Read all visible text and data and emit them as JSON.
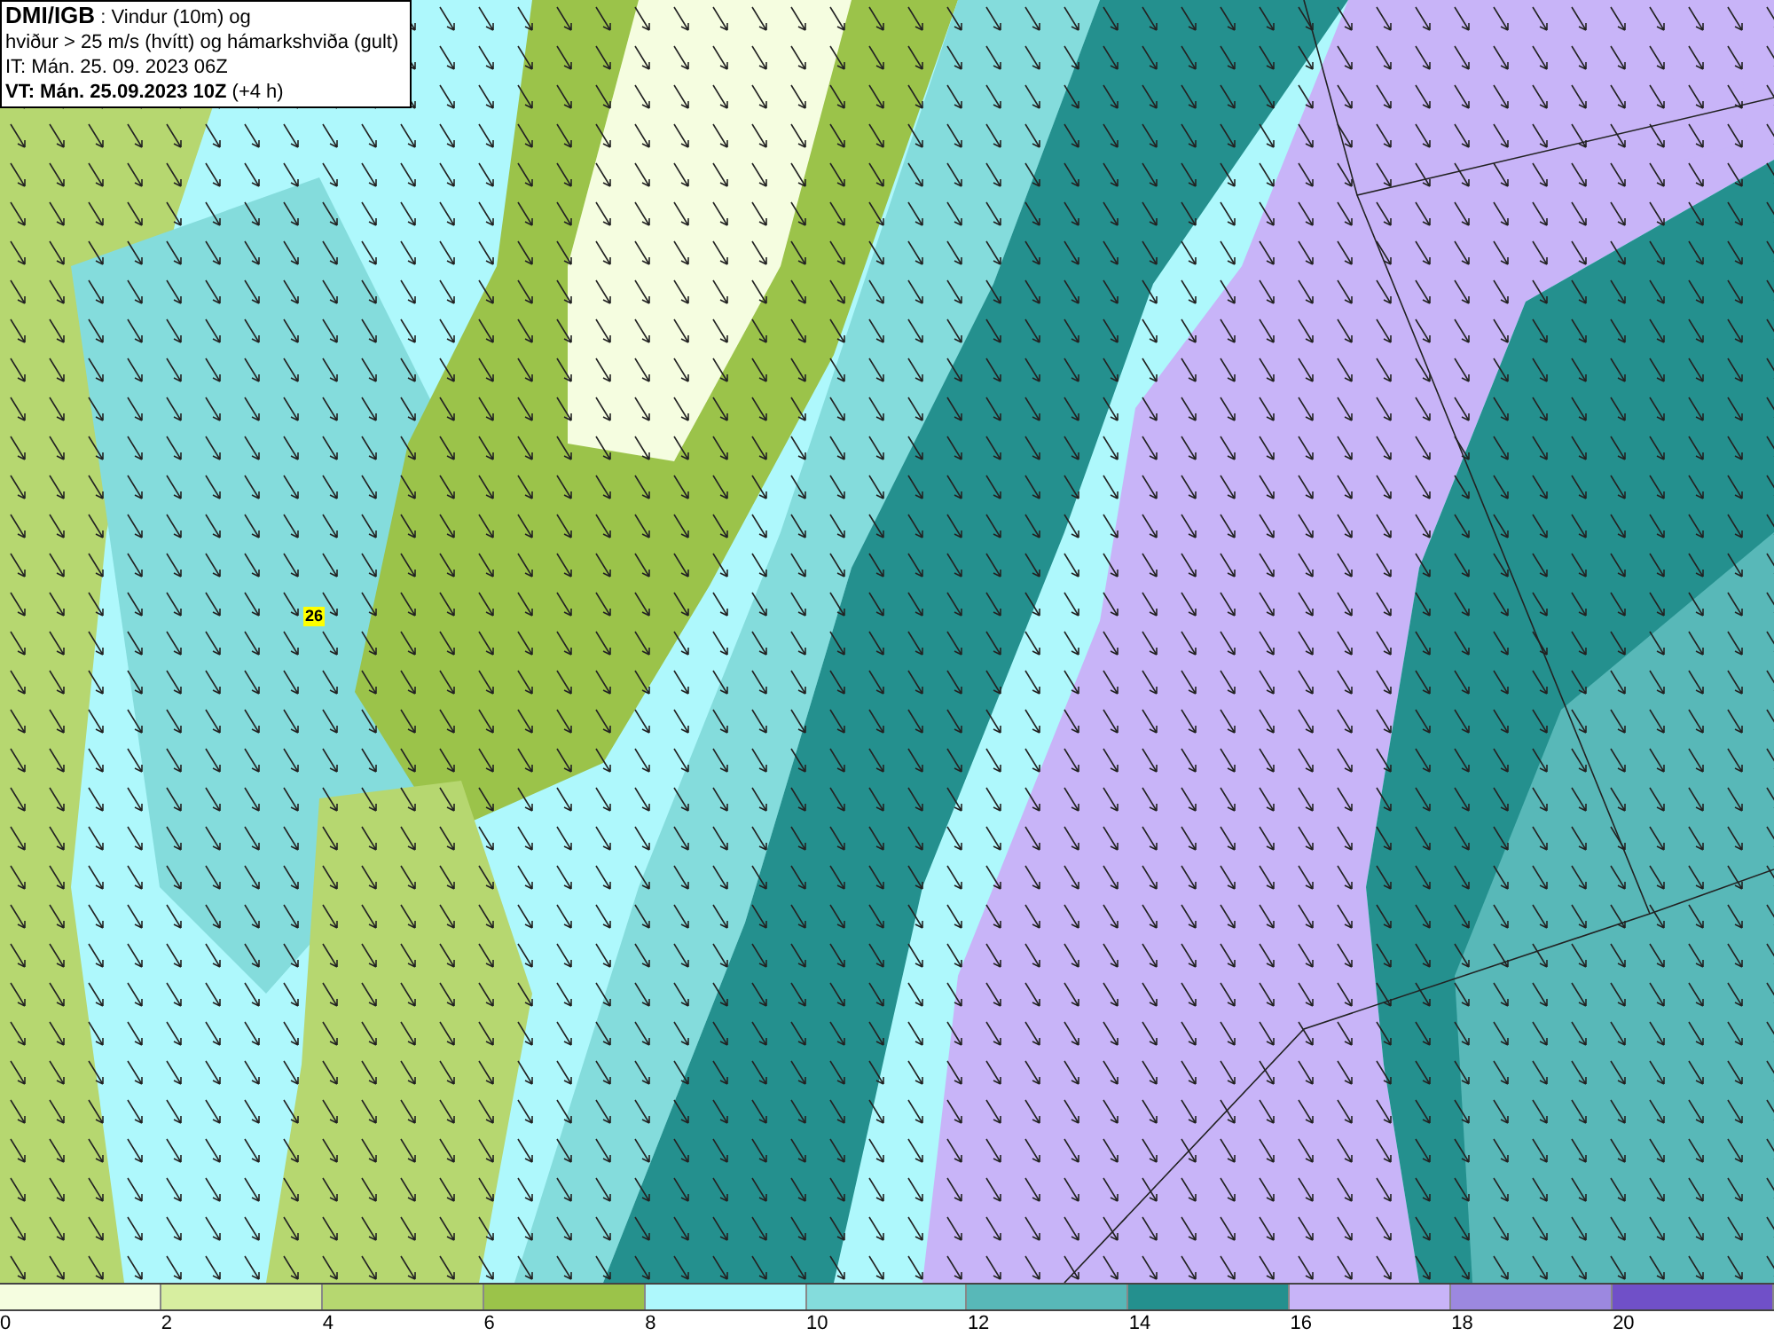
{
  "header": {
    "source": "DMI/IGB",
    "title": ": Vindur (10m) og",
    "subtitle": "hviður > 25 m/s (hvítt) og hámarkshviða (gult)",
    "issue_time": "IT: Mán. 25. 09. 2023 06Z",
    "valid_time": "VT: Mán. 25.09.2023 10Z",
    "lead": "(+4 h)"
  },
  "gust_marker": {
    "value": "26"
  },
  "legend": {
    "bins": [
      {
        "color": "#f5fde0"
      },
      {
        "color": "#d7eea0"
      },
      {
        "color": "#b6d770"
      },
      {
        "color": "#9bc34a"
      },
      {
        "color": "#aef8fc"
      },
      {
        "color": "#84dcdc"
      },
      {
        "color": "#58b8b8"
      },
      {
        "color": "#24908e"
      },
      {
        "color": "#c8b4f8"
      },
      {
        "color": "#9c88e0"
      },
      {
        "color": "#7050c8"
      }
    ],
    "ticks": [
      "0",
      "2",
      "4",
      "6",
      "8",
      "10",
      "12",
      "14",
      "16",
      "18",
      "20"
    ]
  }
}
